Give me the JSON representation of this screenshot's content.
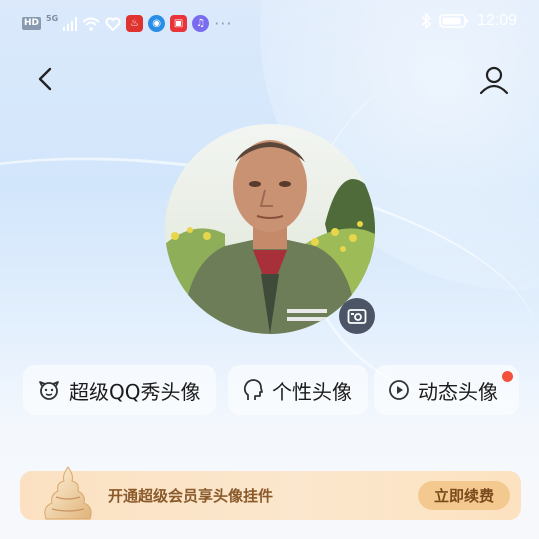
{
  "status_bar": {
    "hd_label": "HD",
    "network_label": "5G",
    "more_dots": "···",
    "time": "12:09"
  },
  "header": {
    "back_icon": "chevron-left-icon",
    "profile_icon": "user-icon"
  },
  "avatar": {
    "camera_icon": "camera-icon"
  },
  "options": [
    {
      "label": "超级QQ秀头像",
      "icon": "qq-show-icon"
    },
    {
      "label": "个性头像",
      "icon": "personal-avatar-icon"
    },
    {
      "label": "动态头像",
      "icon": "play-circle-icon",
      "has_notification": true
    }
  ],
  "banner": {
    "text": "开通超级会员享头像挂件",
    "button_label": "立即续费"
  },
  "colors": {
    "accent_notification": "#f4513d",
    "banner_bg": "#fbe1c2",
    "banner_button": "#f3c98f",
    "banner_text": "#8b5a2b"
  }
}
